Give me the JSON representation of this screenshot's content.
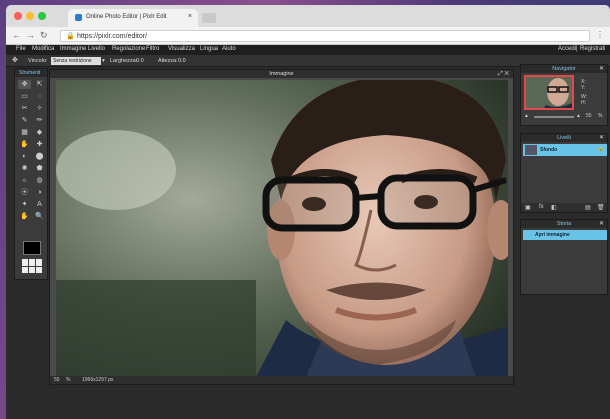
{
  "browser": {
    "tab_title": "Online Photo Editor | Pixlr Edit",
    "tab_close": "×",
    "url": "https://pixlr.com/editor/",
    "back": "←",
    "forward": "→",
    "reload": "↻",
    "lock": "🔒",
    "menu": "⋮"
  },
  "menu": {
    "items": [
      "File",
      "Modifica",
      "Immagine",
      "Livello",
      "Regolazione",
      "Filtro",
      "Visualizza",
      "Lingua",
      "Aiuto"
    ],
    "right": [
      "Accedi",
      "|",
      "Registrati"
    ]
  },
  "options": {
    "tool_icon": "✥",
    "vincolo_label": "Vincolo:",
    "vincolo_value": "Senza restrizione",
    "larghezza_label": "Larghezza:",
    "larghezza_value": "0.0",
    "altezza_label": "Altezza:",
    "altezza_value": "0.0"
  },
  "tools": {
    "title": "Strumenti",
    "icons": [
      "✥",
      "⇱",
      "▭",
      "◌",
      "✂",
      "✧",
      "✎",
      "✏",
      "▦",
      "◆",
      "✋",
      "✚",
      "◐",
      "⬤",
      "✺",
      "⬟",
      "☼",
      "◍",
      "⦿",
      "◑",
      "✦",
      "A",
      "✋",
      "🔍"
    ]
  },
  "image_window": {
    "title": "Immagine",
    "controls": "⤢ ✕",
    "status_zoom": "55",
    "status_pct": "%",
    "status_size": "1966x1297 px"
  },
  "navigator": {
    "title": "Navigator",
    "close": "✕",
    "x_label": "X:",
    "y_label": "Y:",
    "w_label": "W:",
    "h_label": "H:",
    "zoom_value": "55",
    "zoom_unit": "%"
  },
  "layers": {
    "title": "Livelli",
    "close": "✕",
    "layer_name": "Sfondo",
    "lock": "🔒",
    "footer_icons": [
      "▣",
      "fx",
      "◧",
      "▤",
      "🗑"
    ]
  },
  "history": {
    "title": "Storia",
    "close": "✕",
    "entry": "Apri immagine"
  },
  "colors": {
    "accent": "#69c3e6",
    "panel": "#3b3b3b",
    "dark": "#2b2b2b"
  }
}
